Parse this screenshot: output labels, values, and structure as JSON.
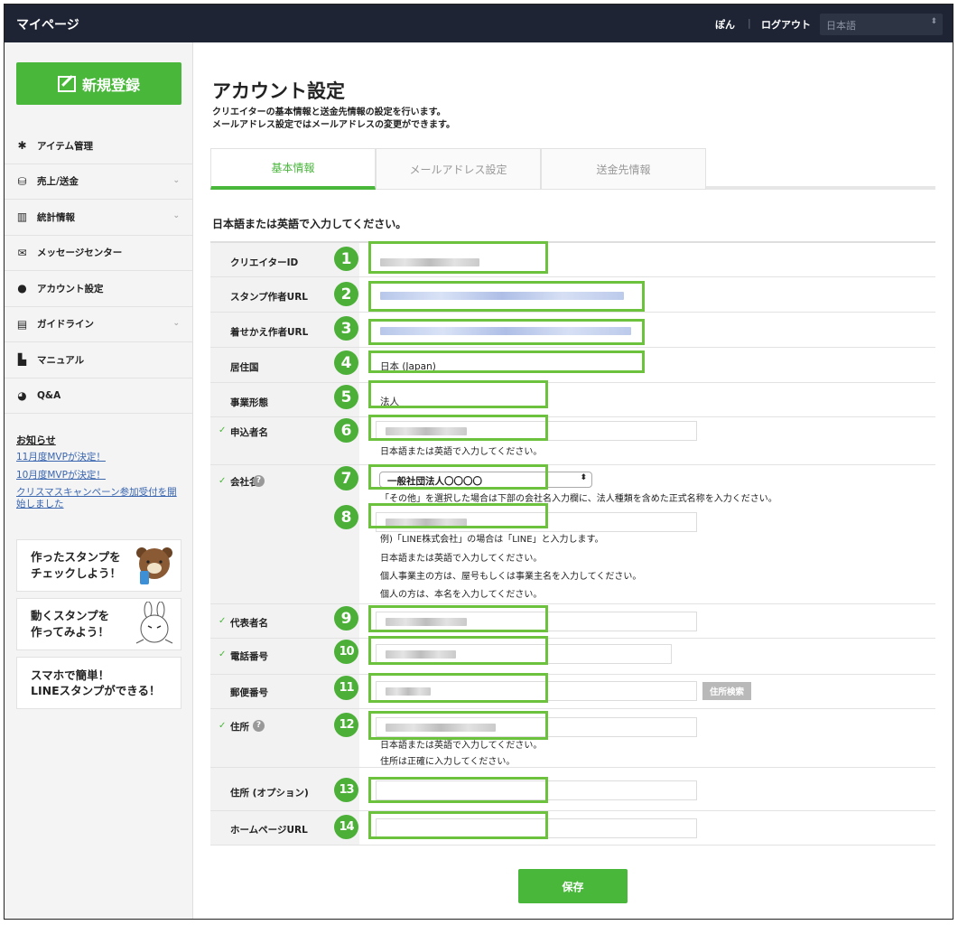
{
  "header": {
    "title": "マイページ",
    "user": "ぽん",
    "separator": "|",
    "logout": "ログアウト",
    "language": "日本語"
  },
  "sidebar": {
    "new_button": "新規登録",
    "items": [
      {
        "label": "アイテム管理",
        "icon": "gear-icon"
      },
      {
        "label": "売上/送金",
        "icon": "coins-icon"
      },
      {
        "label": "統計情報",
        "icon": "bar-chart-icon"
      },
      {
        "label": "メッセージセンター",
        "icon": "envelope-icon"
      },
      {
        "label": "アカウント設定",
        "icon": "person-icon"
      },
      {
        "label": "ガイドライン",
        "icon": "document-icon"
      },
      {
        "label": "マニュアル",
        "icon": "file-icon"
      },
      {
        "label": "Q&A",
        "icon": "chat-bubble-icon"
      }
    ],
    "news_heading": "お知らせ",
    "news": [
      "11月度MVPが決定！",
      "10月度MVPが決定！",
      "クリスマスキャンペーン参加受付を開始しました"
    ],
    "promos": [
      {
        "line1": "作ったスタンプを",
        "line2": "チェックしよう！"
      },
      {
        "line1": "動くスタンプを",
        "line2": "作ってみよう！"
      },
      {
        "line1": "スマホで簡単！",
        "line2": "LINEスタンプができる！"
      }
    ]
  },
  "page": {
    "title": "アカウント設定",
    "desc1": "クリエイターの基本情報と送金先情報の設定を行います。",
    "desc2": "メールアドレス設定ではメールアドレスの変更ができます。",
    "tabs": [
      "基本情報",
      "メールアドレス設定",
      "送金先情報"
    ],
    "note": "日本語または英語で入力してください。"
  },
  "form": {
    "creator_id": "クリエイターID",
    "stamp_url": "スタンプ作者URL",
    "theme_url": "着せかえ作者URL",
    "country_label": "居住国",
    "country_value": "日本 (Japan)",
    "business_label": "事業形態",
    "business_value": "法人",
    "applicant": "申込者名",
    "hint_jp_en": "日本語または英語で入力してください。",
    "company": "会社名",
    "company_select": "一般社団法人〇〇〇〇",
    "company_hint1": "「その他」を選択した場合は下部の会社名入力欄に、法人種類を含めた正式名称を入力ください。",
    "company_hint2": "例)「LINE株式会社」の場合は「LINE」と入力します。",
    "company_hint3": "日本語または英語で入力してください。",
    "company_hint4": "個人事業主の方は、屋号もしくは事業主名を入力してください。",
    "company_hint5": "個人の方は、本名を入力してください。",
    "representative": "代表者名",
    "phone": "電話番号",
    "postal": "郵便番号",
    "address_search": "住所検索",
    "address": "住所",
    "address_hint1": "日本語または英語で入力してください。",
    "address_hint2": "住所は正確に入力してください。",
    "address_opt": "住所 (オプション)",
    "homepage": "ホームページURL",
    "save": "保存"
  },
  "callouts": [
    "1",
    "2",
    "3",
    "4",
    "5",
    "6",
    "7",
    "8",
    "9",
    "10",
    "11",
    "12",
    "13",
    "14"
  ],
  "colors": {
    "accent": "#48b73a",
    "callout": "#6cc13d",
    "header": "#1e2433"
  }
}
